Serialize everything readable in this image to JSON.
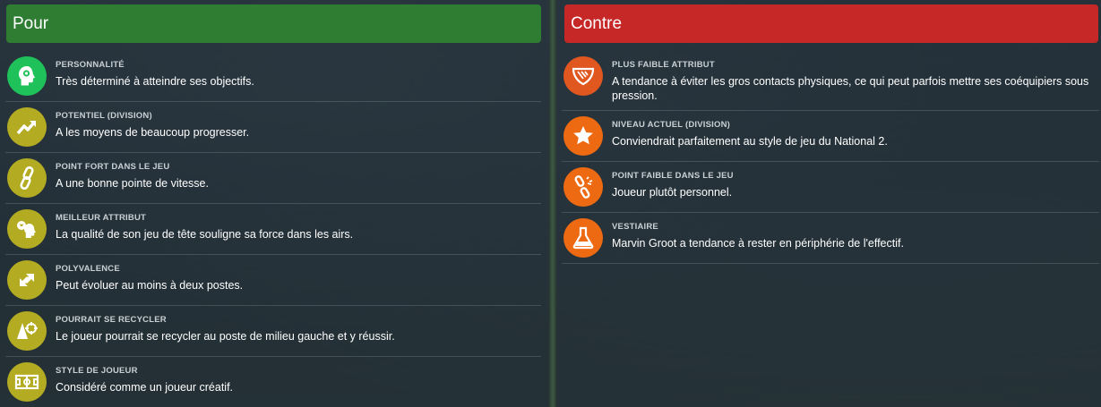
{
  "pros": {
    "title": "Pour",
    "color": "#2e7d32",
    "items": [
      {
        "icon": "head-target-icon",
        "label": "PERSONNALITÉ",
        "text": "Très déterminé à atteindre ses objectifs."
      },
      {
        "icon": "trend-up-icon",
        "label": "POTENTIEL (DIVISION)",
        "text": "A les moyens de beaucoup progresser."
      },
      {
        "icon": "chain-link-icon",
        "label": "POINT FORT DANS LE JEU",
        "text": "A une bonne pointe de vitesse."
      },
      {
        "icon": "ball-head-icon",
        "label": "MEILLEUR ATTRIBUT",
        "text": "La qualité de son jeu de tête souligne sa force dans les airs."
      },
      {
        "icon": "swap-arrows-icon",
        "label": "POLYVALENCE",
        "text": "Peut évoluer au moins à deux postes."
      },
      {
        "icon": "cone-target-icon",
        "label": "POURRAIT SE RECYCLER",
        "text": "Le joueur pourrait se recycler au poste de milieu gauche et y réussir."
      },
      {
        "icon": "pitch-icon",
        "label": "STYLE DE JOUEUR",
        "text": "Considéré comme un joueur créatif."
      }
    ]
  },
  "cons": {
    "title": "Contre",
    "color": "#c62828",
    "items": [
      {
        "icon": "shield-stripes-icon",
        "label": "PLUS FAIBLE ATTRIBUT",
        "text": "A tendance à éviter les gros contacts physiques, ce qui peut parfois mettre ses coéquipiers sous pression."
      },
      {
        "icon": "star-icon",
        "label": "NIVEAU ACTUEL (DIVISION)",
        "text": "Conviendrait parfaitement au style de jeu du National 2."
      },
      {
        "icon": "broken-link-icon",
        "label": "POINT FAIBLE DANS LE JEU",
        "text": "Joueur plutôt personnel."
      },
      {
        "icon": "flask-icon",
        "label": "VESTIAIRE",
        "text": "Marvin Groot a tendance à rester en périphérie de l'effectif."
      }
    ]
  }
}
